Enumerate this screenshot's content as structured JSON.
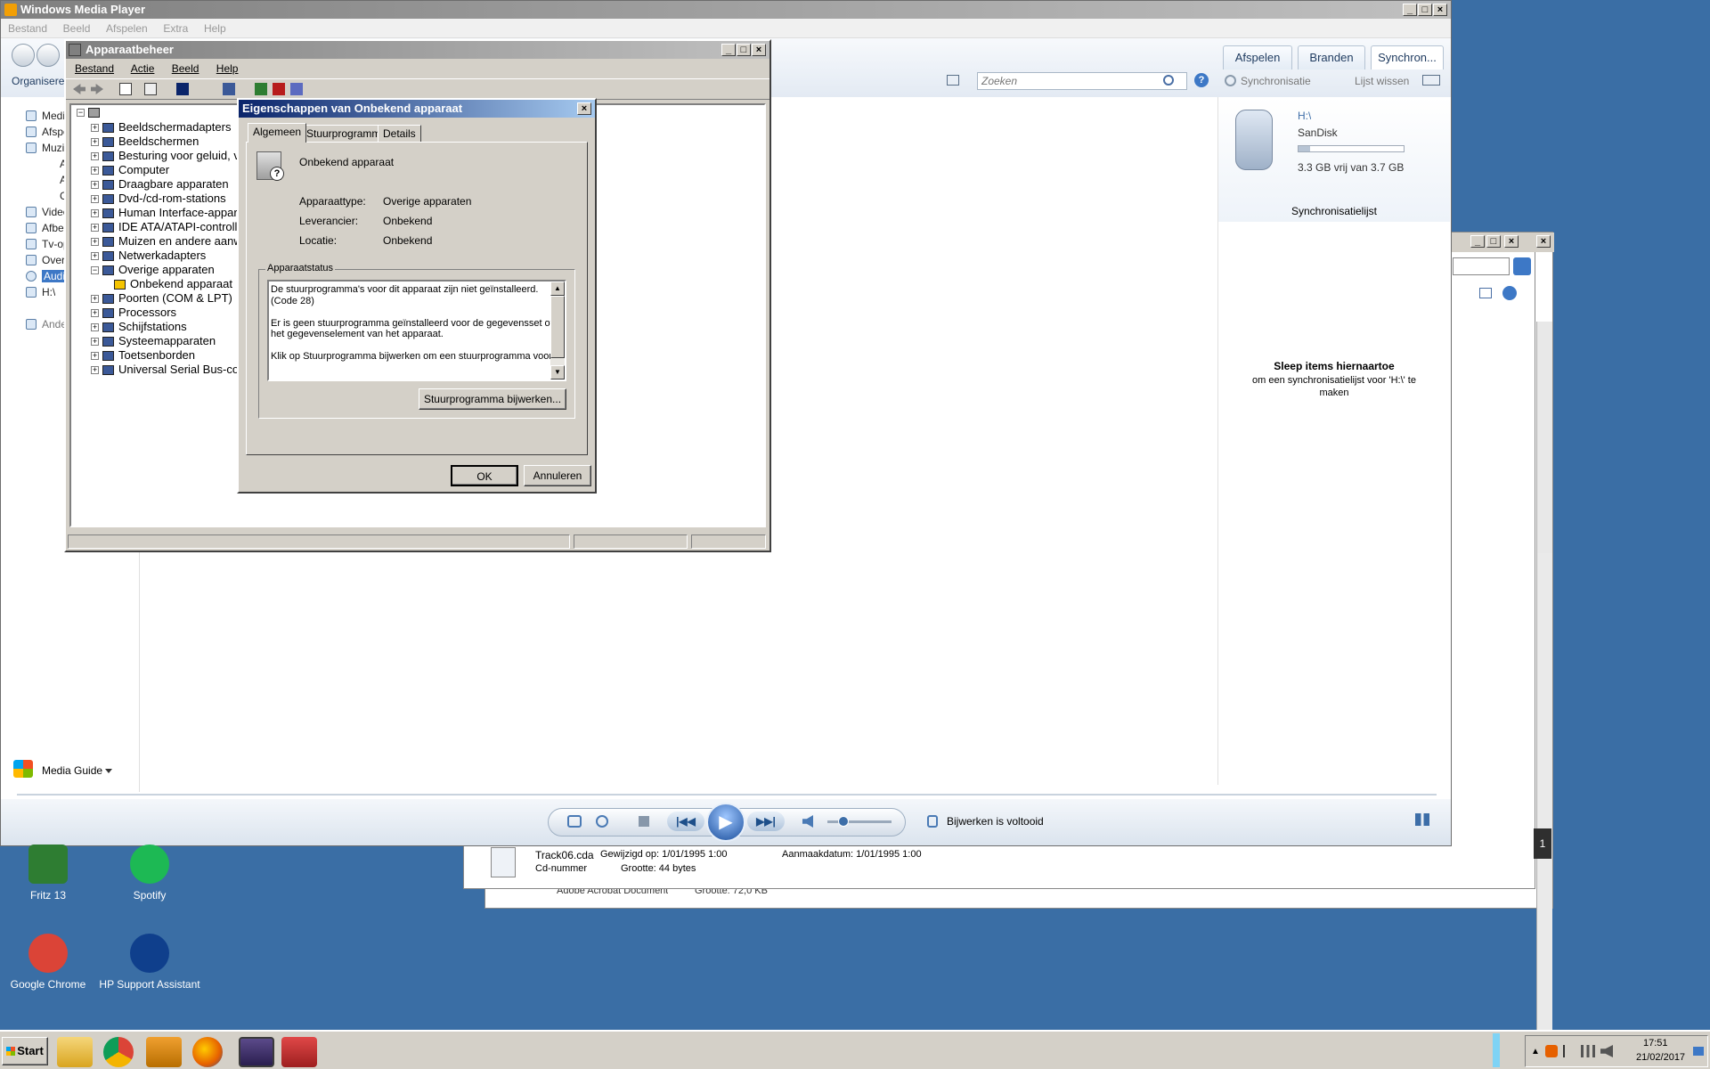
{
  "wmp": {
    "title": "Windows Media Player",
    "menu": [
      "Bestand",
      "Beeld",
      "Afspelen",
      "Extra",
      "Help"
    ],
    "organize": "Organiseren",
    "tabs": [
      "Afspelen",
      "Branden",
      "Synchron..."
    ],
    "search_placeholder": "Zoeken",
    "sync_label": "Synchronisatie",
    "clear_list": "Lijst wissen",
    "nav": [
      "Medi",
      "Afspe",
      "Muzie",
      "A",
      "A",
      "G",
      "Videc",
      "Afbe",
      "Tv-op",
      "Over",
      "Audio",
      "H:\\",
      "Ande"
    ],
    "device": {
      "name": "H:\\",
      "brand": "SanDisk",
      "space": "3.3 GB vrij van 3.7 GB",
      "used_fraction": 0.11
    },
    "sync_list_title": "Synchronisatielijst",
    "drag_title": "Sleep items hiernaartoe",
    "drag_sub": "om een synchronisatielijst voor 'H:\\' te maken",
    "media_guide": "Media Guide",
    "status": "Bijwerken is voltooid"
  },
  "dm": {
    "title": "Apparaatbeheer",
    "menu": [
      "Bestand",
      "Actie",
      "Beeld",
      "Help"
    ],
    "tree": [
      "Beeldschermadapters",
      "Beeldschermen",
      "Besturing voor geluid, vide",
      "Computer",
      "Draagbare apparaten",
      "Dvd-/cd-rom-stations",
      "Human Interface-apparate",
      "IDE ATA/ATAPI-controllers",
      "Muizen en andere aanwijsa",
      "Netwerkadapters",
      "Overige apparaten",
      "Onbekend apparaat",
      "Poorten (COM & LPT)",
      "Processors",
      "Schijfstations",
      "Systeemapparaten",
      "Toetsenborden",
      "Universal Serial Bus-contro"
    ]
  },
  "props": {
    "title": "Eigenschappen van Onbekend apparaat",
    "tabs": [
      "Algemeen",
      "Stuurprogramma",
      "Details"
    ],
    "device_name": "Onbekend apparaat",
    "fields": [
      {
        "label": "Apparaattype:",
        "value": "Overige apparaten"
      },
      {
        "label": "Leverancier:",
        "value": "Onbekend"
      },
      {
        "label": "Locatie:",
        "value": "Onbekend"
      }
    ],
    "status_group": "Apparaatstatus",
    "status_lines": [
      "De stuurprogramma's voor dit apparaat zijn niet geïnstalleerd.",
      "(Code 28)",
      "",
      "Er is geen stuurprogramma geïnstalleerd voor de gegevensset of",
      "het gegevenselement van het apparaat.",
      "",
      "Klik op Stuurprogramma bijwerken om een stuurprogramma voor dit"
    ],
    "update_button": "Stuurprogramma bijwerken...",
    "ok": "OK",
    "cancel": "Annuleren"
  },
  "explorer": {
    "file_name": "Track06.cda",
    "modified": "Gewijzigd op: 1/01/1995 1:00",
    "created": "Aanmaakdatum: 1/01/1995 1:00",
    "type": "Cd-nummer",
    "size": "Grootte: 44 bytes",
    "other_type": "Adobe Acrobat Document",
    "other_size": "Grootte: 72,0 KB",
    "badge": "1"
  },
  "desktop": [
    {
      "label": "Fritz 13",
      "color": "#2e7d32"
    },
    {
      "label": "Spotify",
      "color": "#1db954"
    },
    {
      "label": "Google Chrome",
      "color": "#db4437"
    },
    {
      "label": "HP Support Assistant",
      "color": "#0f3f8c"
    }
  ],
  "taskbar": {
    "start": "Start",
    "time": "17:51",
    "date": "21/02/2017"
  }
}
